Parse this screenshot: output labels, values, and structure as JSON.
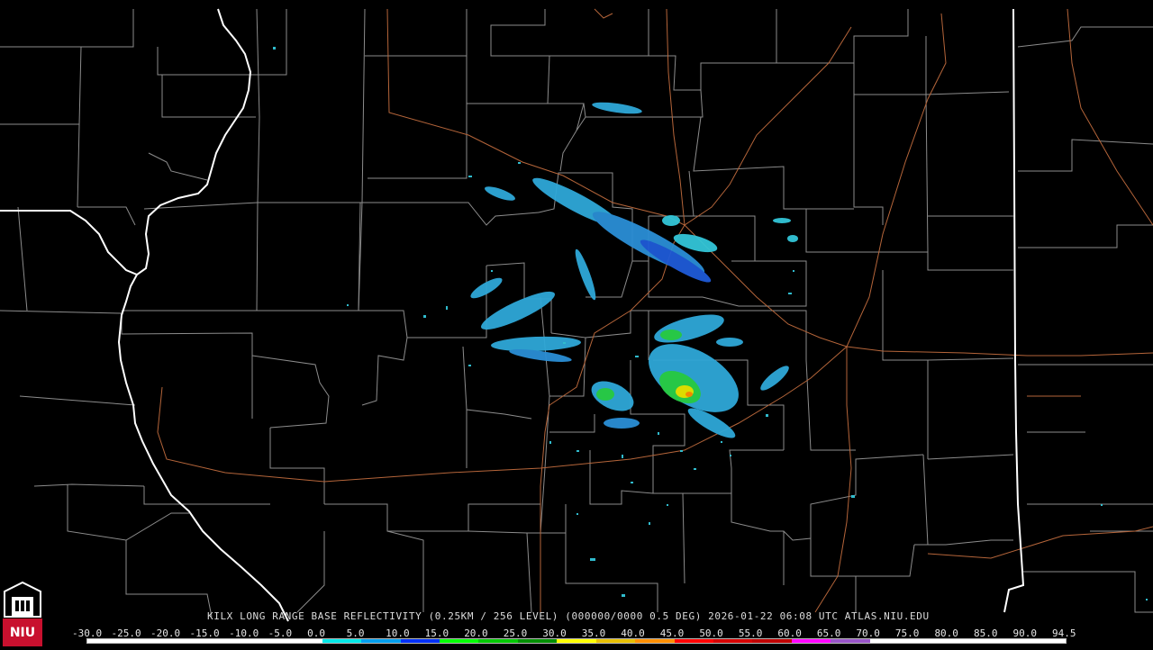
{
  "caption": "KILX LONG RANGE BASE REFLECTIVITY (0.25KM / 256 LEVEL) (000000/0000 0.5 DEG) 2026-01-22 06:08 UTC  ATLAS.NIU.EDU",
  "logo": {
    "text": "NIU",
    "color": "#c8102e"
  },
  "colors": {
    "state_border": "#ffffff",
    "county_border": "#8c8c8c",
    "highway": "#b5653a"
  },
  "scale": {
    "labels": [
      "-30.0",
      "-25.0",
      "-20.0",
      "-15.0",
      "-10.0",
      "-5.0",
      "0.0",
      "5.0",
      "10.0",
      "15.0",
      "20.0",
      "25.0",
      "30.0",
      "35.0",
      "40.0",
      "45.0",
      "50.0",
      "55.0",
      "60.0",
      "65.0",
      "70.0",
      "75.0",
      "80.0",
      "85.0",
      "90.0",
      "94.5"
    ],
    "colors": [
      "#ffffff",
      "#ffffff",
      "#ffffff",
      "#ffffff",
      "#ffffff",
      "#ffffff",
      "#00e8e8",
      "#009fef",
      "#0030f6",
      "#00ff00",
      "#00c800",
      "#009000",
      "#ffff00",
      "#e7c000",
      "#ff9000",
      "#ff0000",
      "#d60000",
      "#c00000",
      "#ff00ff",
      "#9955c9",
      "#ffffff",
      "#ffffff",
      "#ffffff",
      "#ffffff",
      "#ffffff"
    ]
  }
}
